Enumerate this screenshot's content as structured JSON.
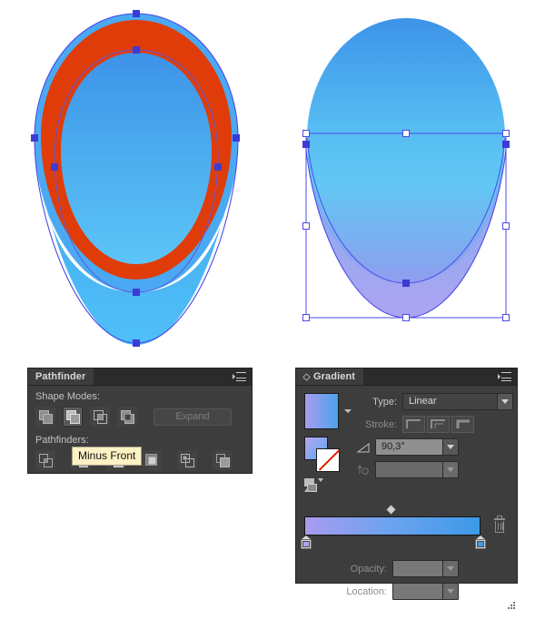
{
  "artwork": {
    "left_shape": {
      "name": "egg-with-red-ring",
      "ring_color": "#e03c0a",
      "inner_gradient_from": "#3d93e8",
      "inner_gradient_to": "#5cc2f5",
      "outline_color": "#4a4ae8",
      "anchor_color": "#3b3bd6"
    },
    "right_shape": {
      "name": "egg-minus-front-result",
      "gradient_top": "#3d9ae8",
      "gradient_mid": "#62c4f2",
      "gradient_bottom": "#9a9bef",
      "selection_color": "#3b3bd6",
      "bbox_handle_fill": "#ffffff"
    }
  },
  "pathfinder": {
    "tab_label": "Pathfinder",
    "shape_modes_label": "Shape Modes:",
    "pathfinders_label": "Pathfinders:",
    "expand_label": "Expand",
    "tooltip": "Minus Front",
    "shape_mode_buttons": [
      {
        "name": "unite",
        "label": "Unite",
        "active": false
      },
      {
        "name": "minus-front",
        "label": "Minus Front",
        "active": true
      },
      {
        "name": "intersect",
        "label": "Intersect",
        "active": false
      },
      {
        "name": "exclude",
        "label": "Exclude",
        "active": false
      }
    ],
    "pathfinder_buttons": [
      {
        "name": "divide",
        "label": "Divide"
      },
      {
        "name": "trim",
        "label": "Trim"
      },
      {
        "name": "merge",
        "label": "Merge"
      },
      {
        "name": "crop",
        "label": "Crop"
      },
      {
        "name": "outline",
        "label": "Outline"
      },
      {
        "name": "minus-back",
        "label": "Minus Back"
      }
    ]
  },
  "gradient": {
    "tab_label": "Gradient",
    "type_label": "Type:",
    "type_value": "Linear",
    "stroke_label": "Stroke:",
    "angle_value": "90,3°",
    "opacity_label": "Opacity:",
    "opacity_value": "",
    "location_label": "Location:",
    "location_value": "",
    "aspect_value": "",
    "preview_from": "#a99bef",
    "preview_to": "#4da2ec",
    "stops": [
      {
        "name": "gradient-stop-start",
        "color": "#a99bef",
        "location_pct": 0
      },
      {
        "name": "gradient-stop-end",
        "color": "#3d9ae8",
        "location_pct": 100
      }
    ],
    "midpoint_pct": 48,
    "stroke_type_buttons": [
      {
        "name": "stroke-within",
        "label": "Apply gradient within stroke"
      },
      {
        "name": "stroke-along",
        "label": "Apply gradient along stroke"
      },
      {
        "name": "stroke-across",
        "label": "Apply gradient across stroke"
      }
    ]
  }
}
